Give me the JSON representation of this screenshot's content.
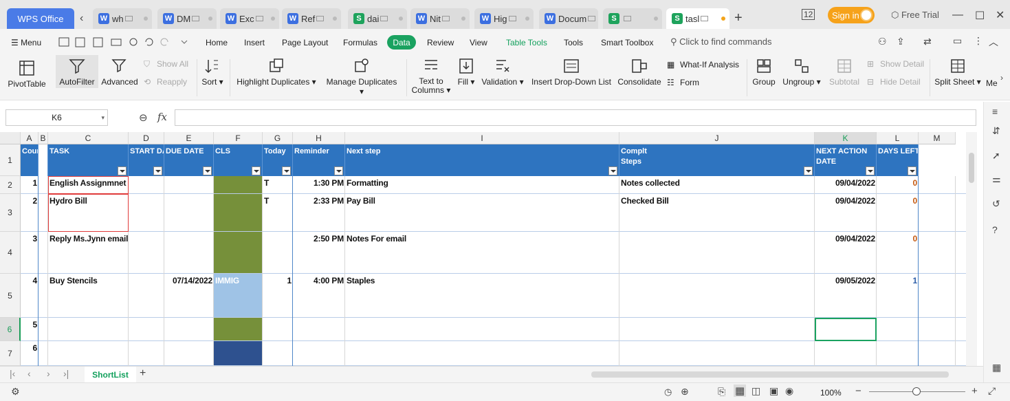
{
  "app": {
    "name": "WPS Office"
  },
  "file_tabs": [
    {
      "type": "w",
      "label": "wh"
    },
    {
      "type": "w",
      "label": "DM"
    },
    {
      "type": "w",
      "label": "Exc"
    },
    {
      "type": "w",
      "label": "Ref"
    },
    {
      "type": "s",
      "label": "dai"
    },
    {
      "type": "w",
      "label": "Nit"
    },
    {
      "type": "w",
      "label": "Hig"
    },
    {
      "type": "w",
      "label": "Docum"
    },
    {
      "type": "s",
      "label": ""
    },
    {
      "type": "s",
      "label": "tasl",
      "active": true
    }
  ],
  "header": {
    "signin": "Sign in",
    "free_trial": "Free Trial"
  },
  "menu": {
    "menu_label": "Menu",
    "items": [
      "Home",
      "Insert",
      "Page Layout",
      "Formulas",
      "Data",
      "Review",
      "View",
      "Table Tools",
      "Tools",
      "Smart Toolbox"
    ],
    "find": "Click to find commands"
  },
  "ribbon": {
    "pivot": "PivotTable",
    "autofilter": "AutoFilter",
    "advanced": "Advanced",
    "showall": "Show All",
    "reapply": "Reapply",
    "sort": "Sort",
    "highlight": "Highlight Duplicates",
    "manage": "Manage Duplicates",
    "t2c1": "Text to",
    "t2c2": "Columns",
    "fill": "Fill",
    "validation": "Validation",
    "dropdown": "Insert Drop-Down List",
    "consolidate": "Consolidate",
    "whatif": "What-If Analysis",
    "form": "Form",
    "group": "Group",
    "ungroup": "Ungroup",
    "subtotal": "Subtotal",
    "showdetail": "Show Detail",
    "hidedetail": "Hide Detail",
    "splitsheet": "Split Sheet",
    "more": "Me"
  },
  "formula": {
    "namebox": "K6",
    "fx": "fx"
  },
  "columns": [
    "A",
    "B",
    "C",
    "D",
    "E",
    "F",
    "G",
    "H",
    "I",
    "J",
    "K",
    "L",
    "M"
  ],
  "rows": [
    "1",
    "2",
    "3",
    "4",
    "5",
    "6",
    "7"
  ],
  "headers": {
    "A": "Coun",
    "C": "TASK",
    "D": "START DAT",
    "E": "DUE DATE",
    "F": "CLS",
    "G": "Today",
    "H": "Reminder",
    "I": "Next step",
    "J1": "Complt",
    "J2": "Steps",
    "K1": "NEXT ACTION",
    "K2": "DATE",
    "L": "DAYS LEFT"
  },
  "data": [
    {
      "a": "1",
      "c": "English Assignmnet",
      "e": "",
      "f": "",
      "g": "T",
      "h": "1:30 PM",
      "i": "Formatting",
      "j": "Notes collected",
      "k": "09/04/2022",
      "l": "0"
    },
    {
      "a": "2",
      "c": "Hydro Bill",
      "e": "",
      "f": "",
      "g": "T",
      "h": "2:33 PM",
      "i": "Pay Bill",
      "j": "Checked Bill",
      "k": "09/04/2022",
      "l": "0"
    },
    {
      "a": "3",
      "c": "Reply Ms.Jynn email",
      "e": "",
      "f": "",
      "g": "",
      "h": "2:50 PM",
      "i": "Notes For email",
      "j": "",
      "k": "09/04/2022",
      "l": "0"
    },
    {
      "a": "4",
      "c": "Buy Stencils",
      "e": "07/14/2022",
      "f": "IMMIG",
      "g": "1",
      "h": "4:00 PM",
      "i": "Staples",
      "j": "",
      "k": "09/05/2022",
      "l": "1"
    },
    {
      "a": "5"
    },
    {
      "a": "6"
    }
  ],
  "colors": {
    "header": "#2e74c0",
    "cls_green": "#76903a",
    "cls_lightblue": "#9fc3e6",
    "cls_navy": "#2e518f",
    "accent": "#1aa260"
  },
  "sheet": {
    "name": "ShortList"
  },
  "status": {
    "zoom": "100%"
  }
}
